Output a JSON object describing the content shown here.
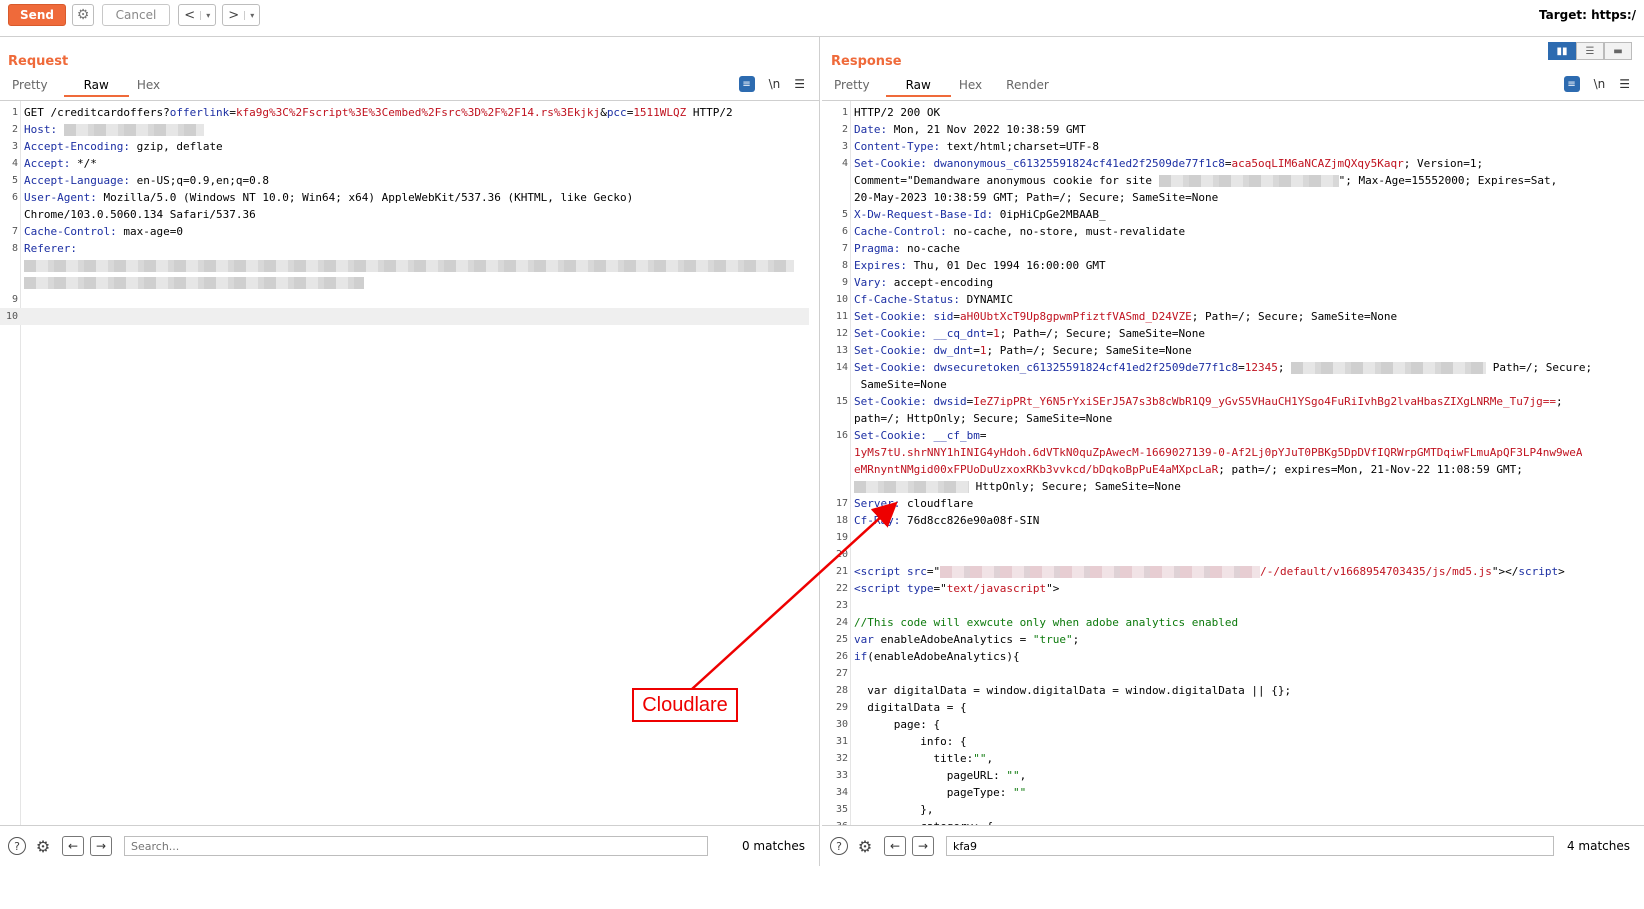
{
  "toolbar": {
    "send": "Send",
    "cancel": "Cancel",
    "back": "<",
    "forward": ">",
    "dropdown": "▾",
    "target": "Target: https:/"
  },
  "request": {
    "title": "Request",
    "tabs": [
      "Pretty",
      "Raw",
      "Hex"
    ],
    "newline_toggle": "\\n",
    "search_placeholder": "Search...",
    "matches": "0 matches"
  },
  "response": {
    "title": "Response",
    "tabs": [
      "Pretty",
      "Raw",
      "Hex",
      "Render"
    ],
    "newline_toggle": "\\n",
    "search_value": "kfa9",
    "matches": "4 matches"
  },
  "annotation": {
    "label": "Cloudlare"
  },
  "colors": {
    "accent": "#ef6a3a",
    "key": "#1c2fa3",
    "value": "#c0121f",
    "comment": "#0d7a0d",
    "annotation": "#e00000"
  }
}
